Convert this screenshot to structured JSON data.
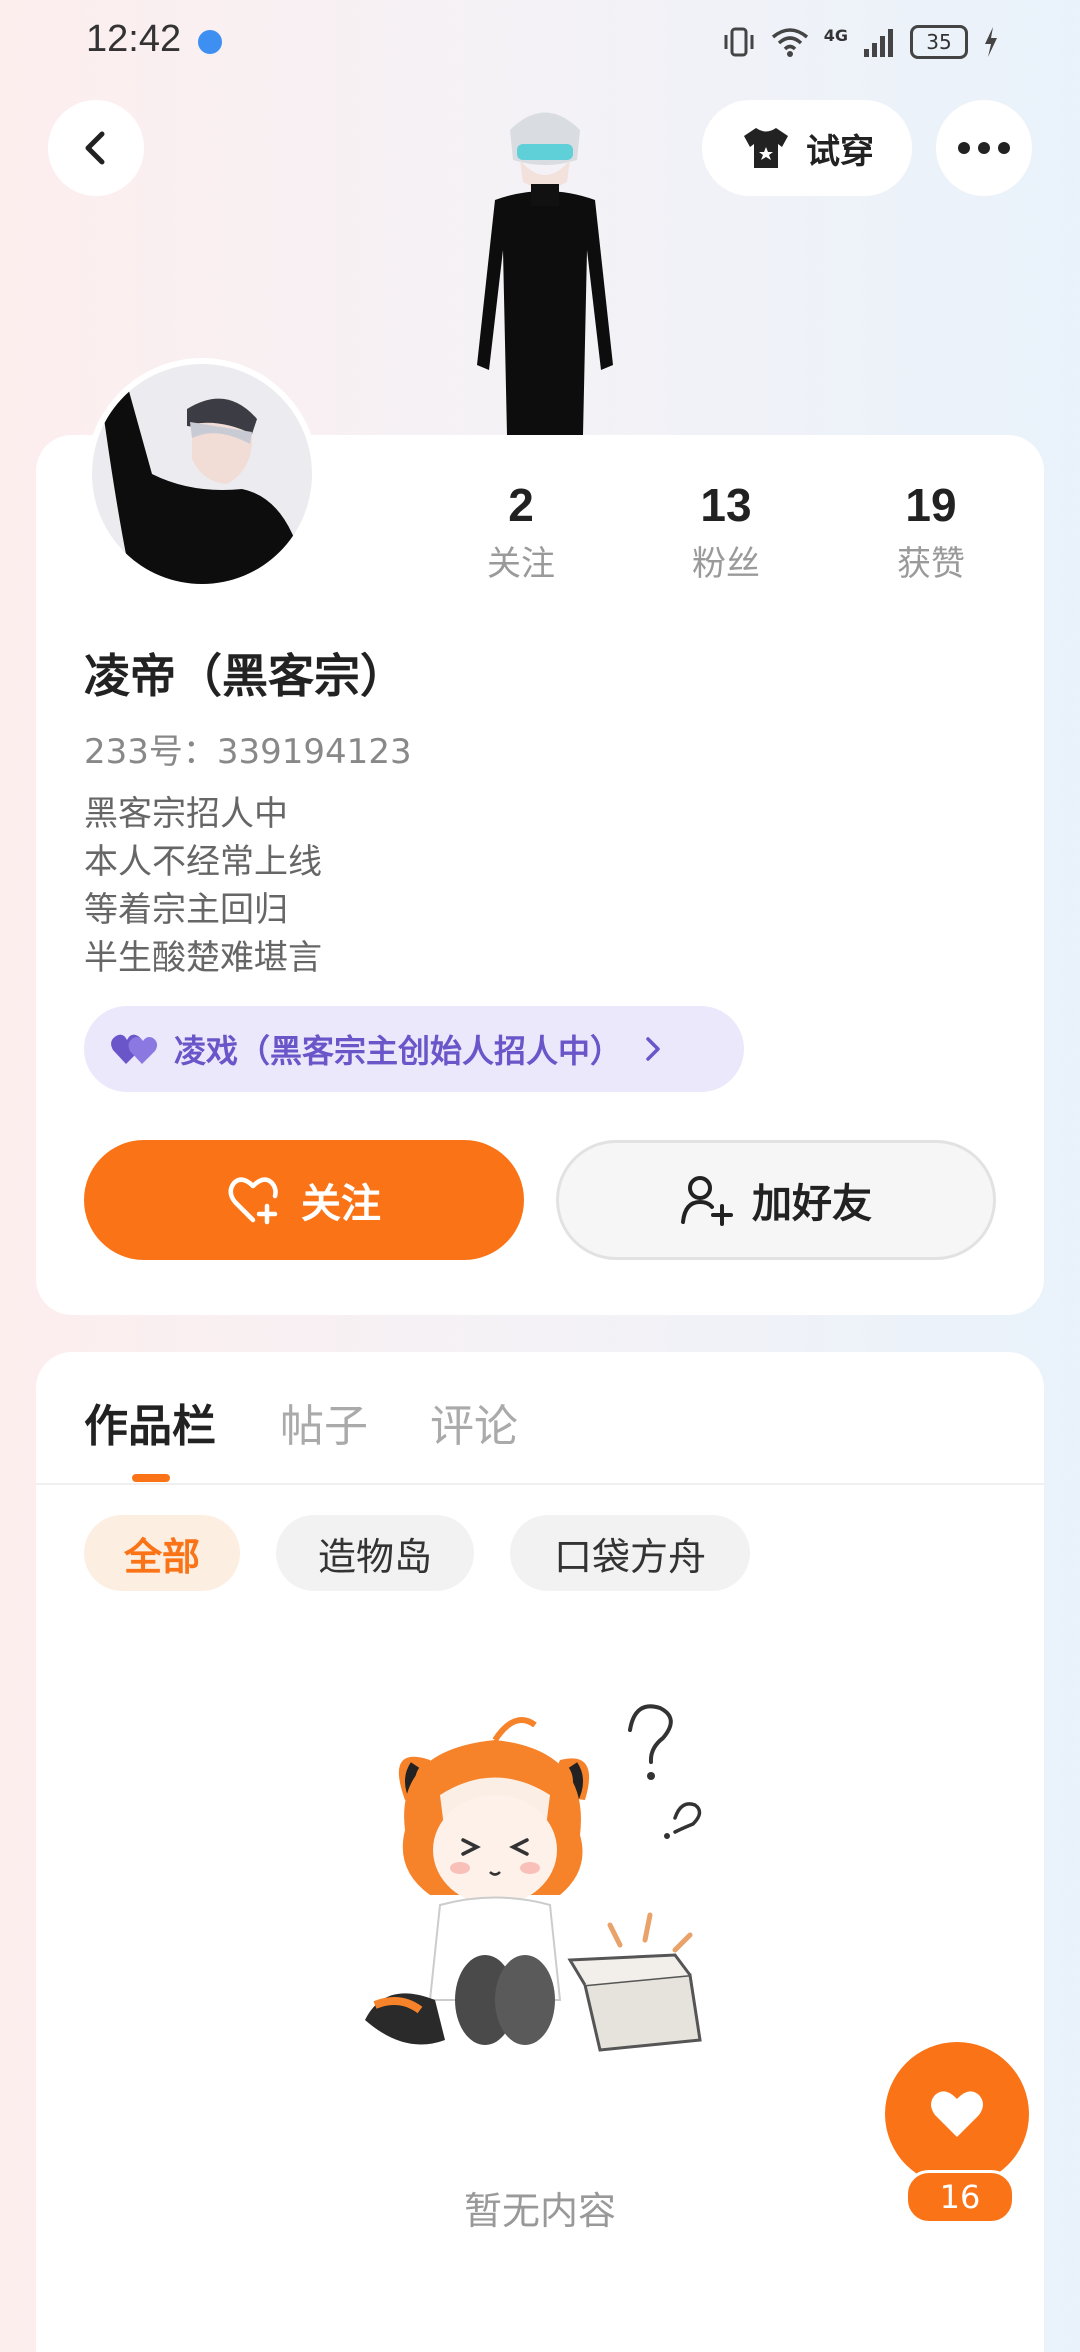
{
  "status_bar": {
    "time": "12:42",
    "network": "4G",
    "battery": "35"
  },
  "header": {
    "tryon_label": "试穿"
  },
  "profile": {
    "stats": [
      {
        "value": "2",
        "label": "关注"
      },
      {
        "value": "13",
        "label": "粉丝"
      },
      {
        "value": "19",
        "label": "获赞"
      }
    ],
    "username": "凌帝（黑客宗）",
    "uid": "233号：339194123",
    "bio": [
      "黑客宗招人中",
      "本人不经常上线",
      "等着宗主回归",
      "半生酸楚难堪言"
    ],
    "guild": "凌戏（黑客宗主创始人招人中）",
    "follow_label": "关注",
    "add_friend_label": "加好友"
  },
  "content": {
    "tabs": [
      "作品栏",
      "帖子",
      "评论"
    ],
    "filters": [
      "全部",
      "造物岛",
      "口袋方舟"
    ],
    "empty_text": "暂无内容"
  },
  "floating_like": {
    "count": "16"
  },
  "colors": {
    "accent": "#fa7316",
    "guild_bg": "#ebe8fb",
    "guild_text": "#6a56c9"
  }
}
